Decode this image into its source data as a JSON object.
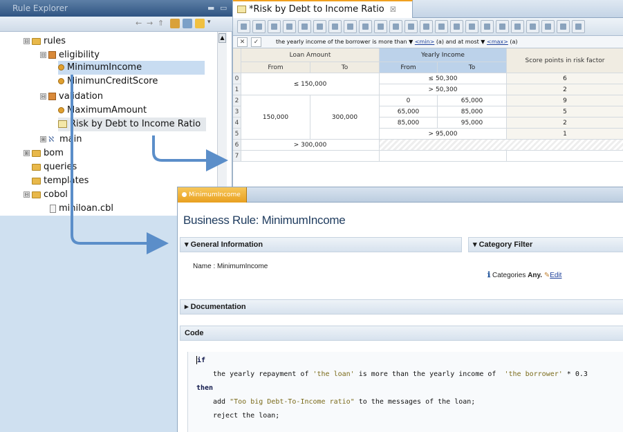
{
  "explorer": {
    "title": "Rule Explorer",
    "items": [
      {
        "label": "rules",
        "icon": "folder-icon",
        "toggle": "⊟"
      },
      {
        "label": "eligibility",
        "icon": "package-icon",
        "toggle": "⊟"
      },
      {
        "label": "MinimumIncome",
        "icon": "rule-icon"
      },
      {
        "label": "MinimunCreditScore",
        "icon": "rule-icon"
      },
      {
        "label": "validation",
        "icon": "package-icon",
        "toggle": "⊟"
      },
      {
        "label": "MaximumAmount",
        "icon": "rule-icon"
      },
      {
        "label": "Risk by Debt to Income Ratio",
        "icon": "decision-table-icon"
      },
      {
        "label": "main",
        "icon": "ruleflow-icon",
        "toggle": "⊞"
      },
      {
        "label": "bom",
        "icon": "folder-icon",
        "toggle": "⊞"
      },
      {
        "label": "queries",
        "icon": "folder-icon"
      },
      {
        "label": "templates",
        "icon": "folder-icon"
      },
      {
        "label": "cobol",
        "icon": "folder-icon",
        "toggle": "⊟"
      },
      {
        "label": "miniloan.cbl",
        "icon": "file-icon"
      }
    ]
  },
  "table_editor": {
    "tab_label": "*Risk by Debt to Income Ratio",
    "tab_close": "☒",
    "condition_text": "the yearly income of the borrower is more than",
    "condition_mid": "and at most",
    "condition_placeholder": "<min>",
    "condition_placeholder2": "<max>",
    "col_loan_amount": "Loan Amount",
    "col_yearly_income": "Yearly Income",
    "col_score": "Score points in risk factor",
    "sub_from": "From",
    "sub_to": "To",
    "sub_from2": "From",
    "sub_to2": "To",
    "rows": [
      {
        "n": "0",
        "loan": "≤ 150,000",
        "income_from": "≤ 50,300",
        "income_to": "",
        "score": "6"
      },
      {
        "n": "1",
        "loan": "",
        "income_from": "> 50,300",
        "income_to": "",
        "score": "2"
      },
      {
        "n": "2",
        "loan_from": "",
        "loan_to": "",
        "income_from": "0",
        "income_to": "65,000",
        "score": "9"
      },
      {
        "n": "3",
        "loan_from": "150,000",
        "loan_to": "300,000",
        "income_from": "65,000",
        "income_to": "85,000",
        "score": "5"
      },
      {
        "n": "4",
        "loan_from": "",
        "loan_to": "",
        "income_from": "85,000",
        "income_to": "95,000",
        "score": "2"
      },
      {
        "n": "5",
        "loan": "",
        "income_from": "> 95,000",
        "income_to": "",
        "score": "1"
      },
      {
        "n": "6",
        "loan": "> 300,000",
        "income_from": "",
        "income_to": "",
        "score": ""
      },
      {
        "n": "7",
        "loan": "",
        "income_from": "",
        "income_to": "",
        "score": ""
      }
    ]
  },
  "business_rule": {
    "tab_label": "MinimumIncome",
    "title": "Business Rule: MinimumIncome",
    "general_info_header": "General Information",
    "category_filter_header": "Category Filter",
    "name_label": "Name : MinimumIncome",
    "categories_label": "Categories",
    "categories_value": "Any.",
    "edit_link": "Edit",
    "documentation_header": "Documentation",
    "code_header": "Code",
    "code": {
      "line1": "if",
      "line2_a": "the yearly repayment of ",
      "line2_b": "'the loan'",
      "line2_c": " is more than the yearly income of  ",
      "line2_d": "'the borrower'",
      "line2_e": " * 0.3",
      "line3": "then",
      "line4_a": "add ",
      "line4_b": "\"Too big Debt-To-Income ratio\"",
      "line4_c": " to the messages of the loan;",
      "line5": "reject the loan;"
    }
  },
  "colors": {
    "accent_blue": "#5b8ec9",
    "selection": "#c8dcf1"
  }
}
